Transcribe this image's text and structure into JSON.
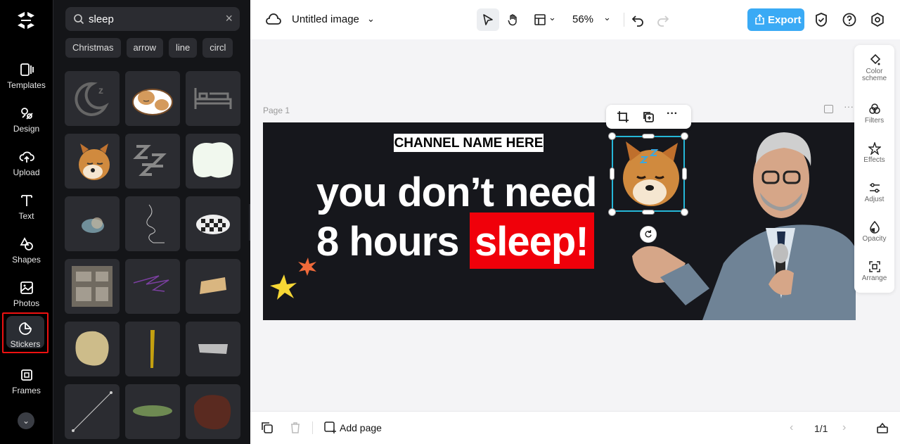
{
  "sidebar": {
    "items": [
      {
        "label": "Templates",
        "icon": "templates-icon"
      },
      {
        "label": "Design",
        "icon": "design-icon"
      },
      {
        "label": "Upload",
        "icon": "upload-icon"
      },
      {
        "label": "Text",
        "icon": "text-icon"
      },
      {
        "label": "Shapes",
        "icon": "shapes-icon"
      },
      {
        "label": "Photos",
        "icon": "photos-icon"
      },
      {
        "label": "Stickers",
        "icon": "stickers-icon",
        "active": true
      },
      {
        "label": "Frames",
        "icon": "frames-icon"
      }
    ]
  },
  "stickers_panel": {
    "search_value": "sleep",
    "chips": [
      "Christmas",
      "arrow",
      "line",
      "circl"
    ],
    "tiles": [
      "moon-zz",
      "sleeping-cat",
      "bed",
      "sleeping-shiba",
      "zzz",
      "white-blob",
      "blurred-shape",
      "squiggle-line",
      "checker-cloud",
      "window-frame",
      "purple-scribble",
      "tape-strip",
      "beige-blob",
      "yellow-stroke",
      "grey-tape",
      "dotted-line",
      "green-disc",
      "brown-blob"
    ]
  },
  "topbar": {
    "title": "Untitled image",
    "zoom": "56%",
    "export_label": "Export"
  },
  "canvas": {
    "page_label": "Page 1",
    "channel_name": "CHANNEL NAME HERE",
    "headline_line1": "you don’t need",
    "headline_line2_part1": "8 hours",
    "headline_line2_highlight": "sleep!",
    "zz_text": "z z z"
  },
  "right_panel": {
    "items": [
      {
        "label": "Color scheme",
        "icon": "color-scheme-icon"
      },
      {
        "label": "Filters",
        "icon": "filters-icon"
      },
      {
        "label": "Effects",
        "icon": "effects-icon"
      },
      {
        "label": "Adjust",
        "icon": "adjust-icon"
      },
      {
        "label": "Opacity",
        "icon": "opacity-icon"
      },
      {
        "label": "Arrange",
        "icon": "arrange-icon"
      }
    ]
  },
  "bottombar": {
    "add_page_label": "Add page",
    "pager": "1/1"
  },
  "colors": {
    "accent": "#3aaaf5",
    "selection": "#25b7d8",
    "highlight_red": "#f0000a",
    "canvas_bg": "#16171c"
  }
}
